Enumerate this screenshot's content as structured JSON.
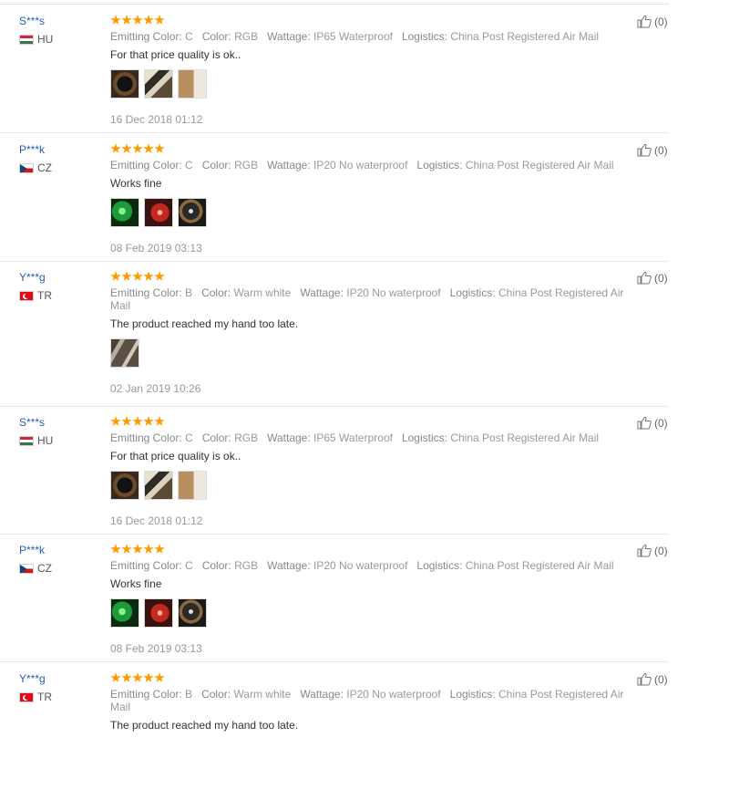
{
  "labels": {
    "emitting_color": "Emitting Color:",
    "color": "Color:",
    "wattage": "Wattage:",
    "logistics": "Logistics:"
  },
  "colors": {
    "star": "#ff9900",
    "username": "#2a5db0",
    "muted": "#999999"
  },
  "reviews": [
    {
      "user": "S***s",
      "country": "HU",
      "flag": "hu",
      "rating": 5,
      "emitting_color": "C",
      "color": "RGB",
      "wattage": "IP65 Waterproof",
      "logistics": "China Post Registered Air Mail",
      "text": "For that price quality is ok..",
      "date": "16 Dec 2018 01:12",
      "helpful": "(0)",
      "thumbs": [
        "photo-remote",
        "photo-led-strip",
        "photo-package"
      ]
    },
    {
      "user": "P***k",
      "country": "CZ",
      "flag": "cz",
      "rating": 5,
      "emitting_color": "C",
      "color": "RGB",
      "wattage": "IP20 No waterproof",
      "logistics": "China Post Registered Air Mail",
      "text": "Works fine",
      "date": "08 Feb 2019 03:13",
      "helpful": "(0)",
      "thumbs": [
        "photo-green-led",
        "photo-red-led",
        "photo-controller"
      ]
    },
    {
      "user": "Y***g",
      "country": "TR",
      "flag": "tr",
      "rating": 5,
      "emitting_color": "B",
      "color": "Warm white",
      "wattage": "IP20 No waterproof",
      "logistics": "China Post Registered Air Mail",
      "text": "The product reached my hand too late.",
      "date": "02 Jan 2019 10:26",
      "helpful": "(0)",
      "thumbs": [
        "photo-strip-closeup"
      ]
    },
    {
      "user": "S***s",
      "country": "HU",
      "flag": "hu",
      "rating": 5,
      "emitting_color": "C",
      "color": "RGB",
      "wattage": "IP65 Waterproof",
      "logistics": "China Post Registered Air Mail",
      "text": "For that price quality is ok..",
      "date": "16 Dec 2018 01:12",
      "helpful": "(0)",
      "thumbs": [
        "photo-remote",
        "photo-led-strip",
        "photo-package"
      ]
    },
    {
      "user": "P***k",
      "country": "CZ",
      "flag": "cz",
      "rating": 5,
      "emitting_color": "C",
      "color": "RGB",
      "wattage": "IP20 No waterproof",
      "logistics": "China Post Registered Air Mail",
      "text": "Works fine",
      "date": "08 Feb 2019 03:13",
      "helpful": "(0)",
      "thumbs": [
        "photo-green-led",
        "photo-red-led",
        "photo-controller"
      ]
    },
    {
      "user": "Y***g",
      "country": "TR",
      "flag": "tr",
      "rating": 5,
      "emitting_color": "B",
      "color": "Warm white",
      "wattage": "IP20 No waterproof",
      "logistics": "China Post Registered Air Mail",
      "text": "The product reached my hand too late.",
      "date": "",
      "helpful": "(0)",
      "thumbs": []
    }
  ]
}
